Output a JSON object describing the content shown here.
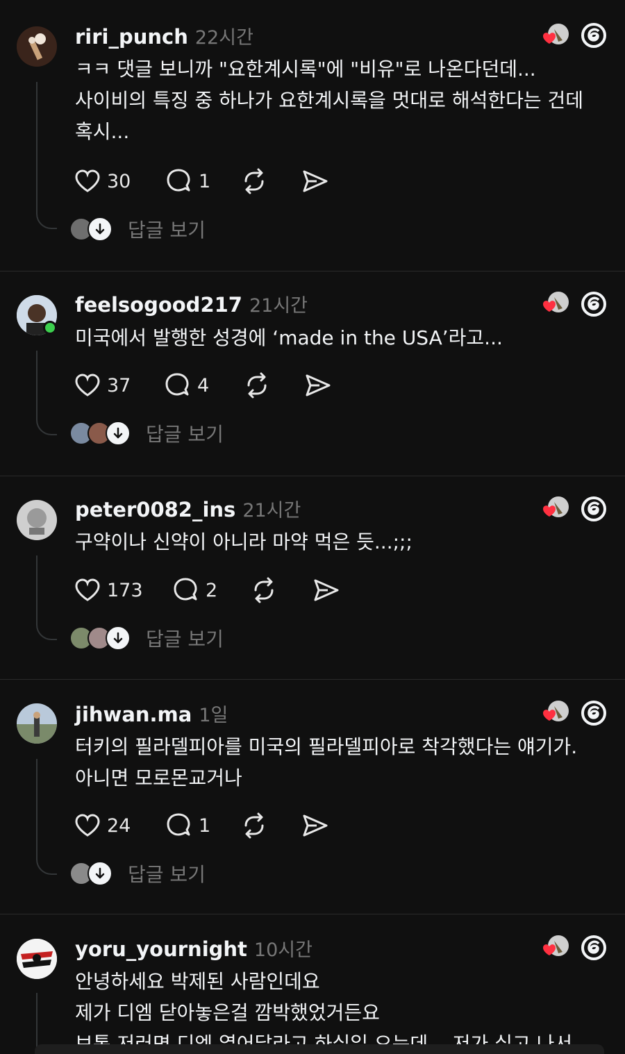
{
  "replies_label": "답글 보기",
  "colors": {
    "background": "#101010",
    "text": "#f3f5f7",
    "muted": "#777777",
    "online": "#3ccf4e"
  },
  "icons": [
    "heart-icon",
    "comment-icon",
    "repost-icon",
    "share-icon",
    "threads-logo-icon",
    "arrow-down-icon"
  ],
  "posts": [
    {
      "username": "riri_punch",
      "time": "22시간",
      "lines": [
        "ㅋㅋ 댓글 보니까 \"요한계시록\"에 \"비유\"로 나온다던데...",
        "사이비의 특징 중 하나가 요한계시록을 멋대로 해석한다는 건데",
        "혹시..."
      ],
      "likes": "30",
      "comments": "1"
    },
    {
      "username": "feelsogood217",
      "time": "21시간",
      "lines": [
        "미국에서 발행한 성경에 ‘made in the USA’라고..."
      ],
      "likes": "37",
      "comments": "4"
    },
    {
      "username": "peter0082_ins",
      "time": "21시간",
      "lines": [
        "구약이나 신약이 아니라 마약 먹은 듯...;;;"
      ],
      "likes": "173",
      "comments": "2"
    },
    {
      "username": "jihwan.ma",
      "time": "1일",
      "lines": [
        "터키의 필라델피아를 미국의 필라델피아로 착각했다는 얘기가.",
        "아니면 모로몬교거나"
      ],
      "likes": "24",
      "comments": "1"
    },
    {
      "username": "yoru_yournight",
      "time": "10시간",
      "lines": [
        "안녕하세요 박제된 사람인데요",
        "제가 디엠 닫아놓은걸 깜박했었거든요",
        "보통 저러면 디엠 열어달라고 하실일 오는데... 저가 실고 나서"
      ]
    }
  ]
}
